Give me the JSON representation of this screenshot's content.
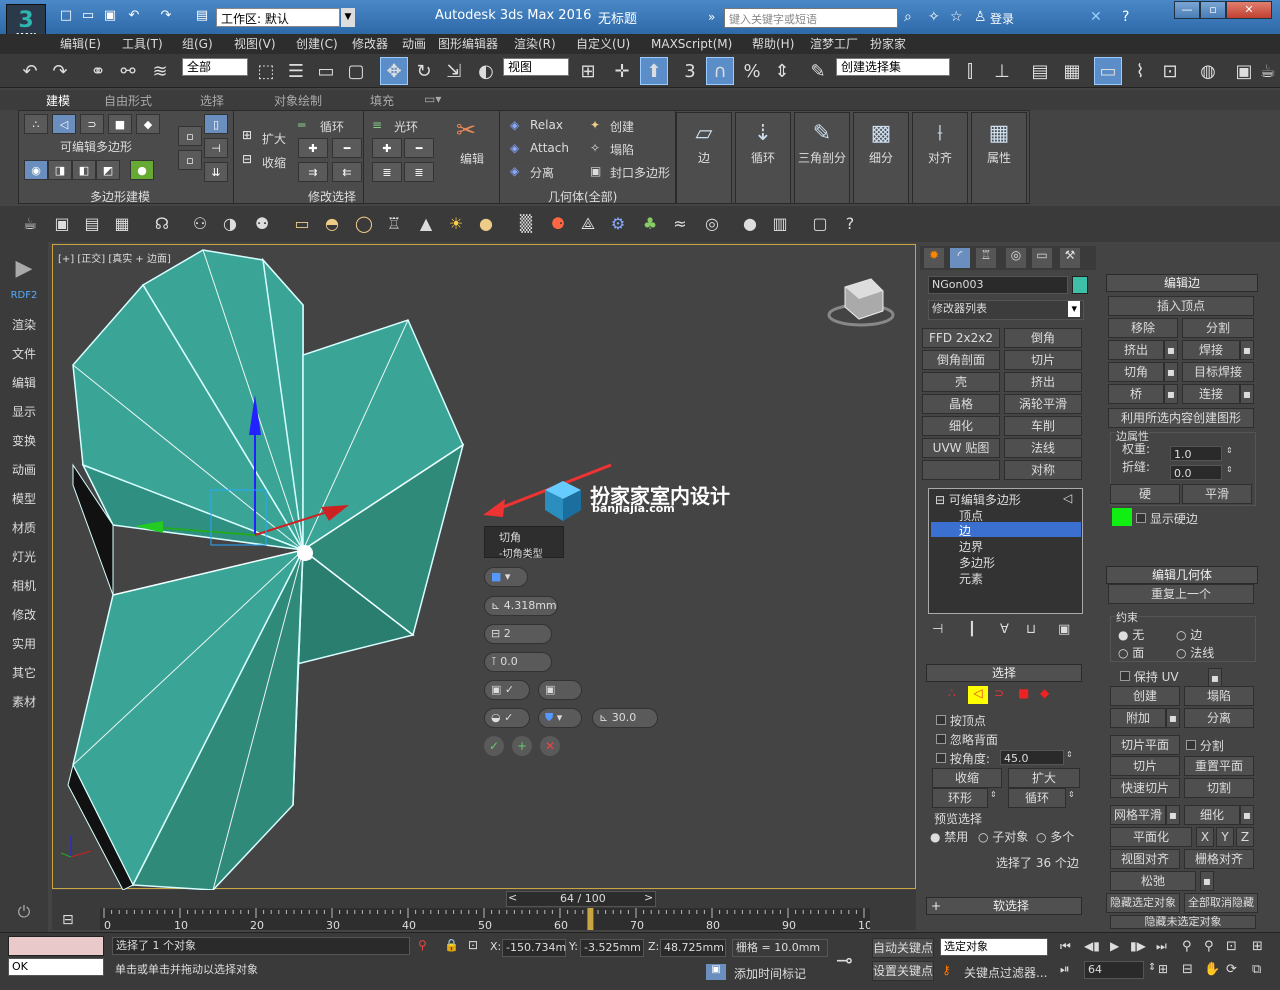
{
  "app": {
    "logo": "MAX",
    "logo_glyph": "3",
    "workspace_label": "工作区: 默认",
    "title": "Autodesk 3ds Max 2016",
    "doc": "无标题",
    "search_placeholder": "键入关键字或短语",
    "login": "登录"
  },
  "menu": [
    "编辑(E)",
    "工具(T)",
    "组(G)",
    "视图(V)",
    "创建(C)",
    "修改器",
    "动画",
    "图形编辑器",
    "渲染(R)",
    "自定义(U)",
    "MAXScript(M)",
    "帮助(H)",
    "渲梦工厂",
    "扮家家"
  ],
  "toolbar1": {
    "select_filter": "全部",
    "ref_coord": "视图",
    "named_sel": "创建选择集",
    "snap_3": "3",
    "snap_pct": "%"
  },
  "ribbon": {
    "tabs": [
      "建模",
      "自由形式",
      "选择",
      "对象绘制",
      "填充"
    ],
    "sections": {
      "poly_modeling": "可编辑多边形",
      "poly_modeling_footer": "多边形建模",
      "modify_sel_footer": "修改选择",
      "grow": "扩大",
      "shrink": "收缩",
      "loop": "循环",
      "ring": "光环",
      "edit": "编辑",
      "relax": "Relax",
      "attach": "Attach",
      "detach": "分离",
      "create": "创建",
      "collapse": "塌陷",
      "cap_poly": "封口多边形",
      "geometry_footer": "几何体(全部)",
      "edge": "边",
      "loop2": "循环",
      "tri": "三角剖分",
      "subdiv": "细分",
      "align": "对齐",
      "props": "属性"
    }
  },
  "leftnav": [
    "RDF2",
    "渲染",
    "文件",
    "编辑",
    "显示",
    "变换",
    "动画",
    "模型",
    "材质",
    "灯光",
    "相机",
    "修改",
    "实用",
    "其它",
    "素材"
  ],
  "viewport": {
    "label": "[+] [正交] [真实 + 边面]",
    "watermark_title": "扮家家室内设计",
    "watermark_url": "banjiajia.com",
    "caddy": {
      "title": "切角",
      "subtitle": "-切角类型",
      "amount": "4.318mm",
      "segments": "2",
      "tension": "0.0",
      "angle": "30.0"
    }
  },
  "command_panel": {
    "object_name": "NGon003",
    "object_color": "#3dbfa8",
    "modifier_list": "修改器列表",
    "mod_buttons": [
      "FFD 2x2x2",
      "倒角",
      "倒角剖面",
      "切片",
      "壳",
      "挤出",
      "晶格",
      "涡轮平滑",
      "细化",
      "车削",
      "UVW 贴图",
      "法线",
      "",
      "对称"
    ],
    "stack": [
      {
        "label": "可编辑多边形"
      },
      {
        "label": "顶点"
      },
      {
        "label": "边"
      },
      {
        "label": "边界"
      },
      {
        "label": "多边形"
      },
      {
        "label": "元素"
      }
    ],
    "selection": {
      "header": "选择",
      "by_vertex": "按顶点",
      "ignore_back": "忽略背面",
      "by_angle": "按角度:",
      "angle_val": "45.0",
      "shrink": "收缩",
      "grow": "扩大",
      "ring": "环形",
      "loop": "循环",
      "preview": "预览选择",
      "preview_off": "禁用",
      "preview_sub": "子对象",
      "preview_multi": "多个",
      "status": "选择了 36 个边"
    },
    "soft_sel": "软选择"
  },
  "edit_edges": {
    "header": "编辑边",
    "insert_vertex": "插入顶点",
    "remove": "移除",
    "split": "分割",
    "extrude": "挤出",
    "weld": "焊接",
    "chamfer": "切角",
    "target_weld": "目标焊接",
    "bridge": "桥",
    "connect": "连接",
    "create_shape": "利用所选内容创建图形",
    "edge_props": "边属性",
    "weight": "权重:",
    "weight_val": "1.0",
    "crease": "折缝:",
    "crease_val": "0.0",
    "hard": "硬",
    "smooth": "平滑",
    "show_hard": "显示硬边"
  },
  "edit_geom": {
    "header": "编辑几何体",
    "repeat": "重复上一个",
    "constraint": "约束",
    "none": "无",
    "edge": "边",
    "face": "面",
    "normal": "法线",
    "keep_uv": "保持 UV",
    "create": "创建",
    "collapse": "塌陷",
    "attach": "附加",
    "detach": "分离",
    "slice_plane": "切片平面",
    "split": "分割",
    "slice": "切片",
    "reset_plane": "重置平面",
    "quickslice": "快速切片",
    "cut": "切割",
    "meshsmooth": "网格平滑",
    "tessellate": "细化",
    "planarize": "平面化",
    "x": "X",
    "y": "Y",
    "z": "Z",
    "view_align": "视图对齐",
    "grid_align": "栅格对齐",
    "relax": "松弛",
    "hide_sel": "隐藏选定对象",
    "unhide_all": "全部取消隐藏",
    "hide_unsel": "隐藏未选定对象"
  },
  "timeline": {
    "frame": "64 / 100",
    "ticks": [
      "0",
      "10",
      "20",
      "30",
      "40",
      "50",
      "60",
      "70",
      "80",
      "90",
      "100"
    ],
    "progress": 0.64
  },
  "status": {
    "ok": "OK",
    "line1": "选择了 1 个对象",
    "line2": "单击或单击并拖动以选择对象",
    "x_label": "X:",
    "x": "-150.734m",
    "y_label": "Y:",
    "y": "-3.525mm",
    "z_label": "Z:",
    "z": "48.725mm",
    "grid": "栅格 = 10.0mm",
    "add_tag": "添加时间标记",
    "autokey": "自动关键点",
    "setkey": "设置关键点",
    "sel_obj": "选定对象",
    "key_filter": "关键点过滤器...",
    "frame": "64"
  }
}
